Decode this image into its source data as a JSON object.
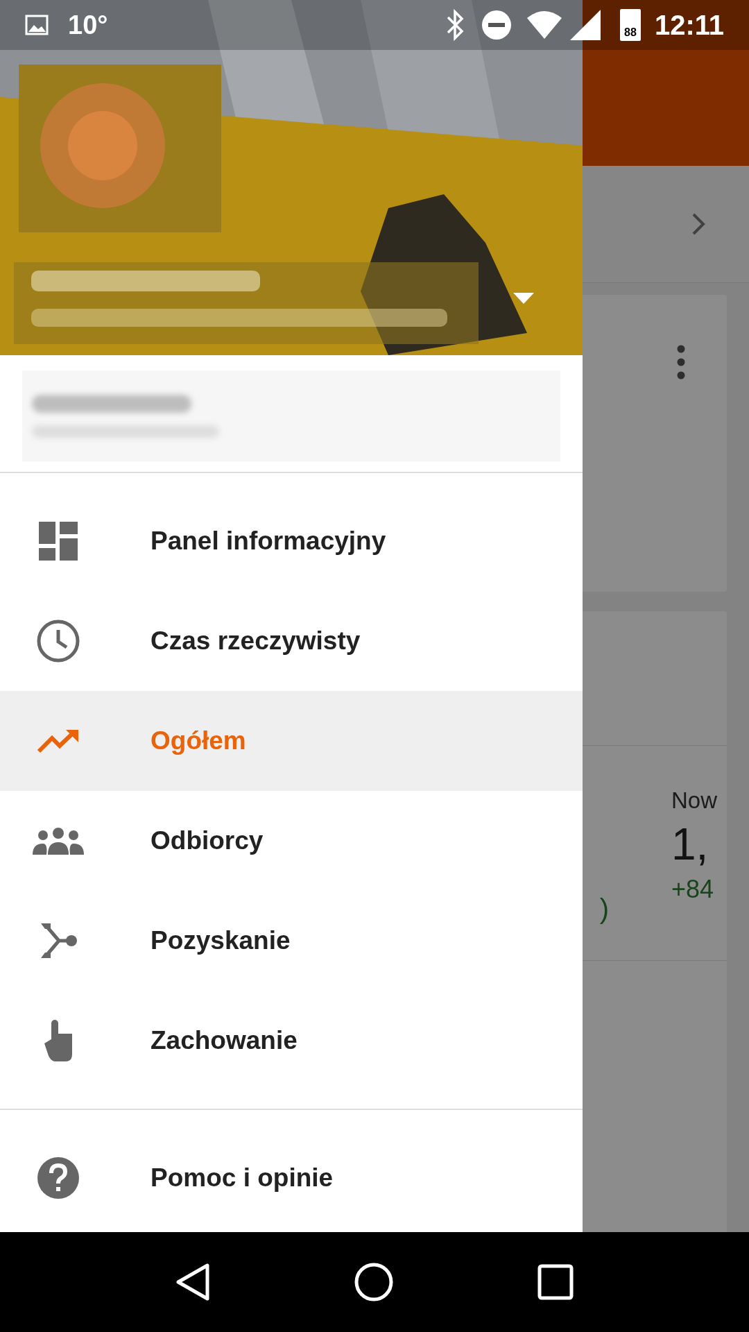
{
  "status_bar": {
    "temperature": "10°",
    "battery": "88",
    "time": "12:11"
  },
  "background_app": {
    "card_texts": [
      {
        "kind": "label",
        "text": "Now"
      },
      {
        "kind": "value",
        "text": "1,"
      },
      {
        "kind": "paren",
        "text": ")"
      },
      {
        "kind": "delta",
        "text": "+84"
      }
    ]
  },
  "drawer": {
    "menu": [
      {
        "kind": "dashboard",
        "label": "Panel informacyjny",
        "selected": false
      },
      {
        "kind": "clock",
        "label": "Czas rzeczywisty",
        "selected": false
      },
      {
        "kind": "trend",
        "label": "Ogółem",
        "selected": true
      },
      {
        "kind": "people",
        "label": "Odbiorcy",
        "selected": false
      },
      {
        "kind": "merge",
        "label": "Pozyskanie",
        "selected": false
      },
      {
        "kind": "touch",
        "label": "Zachowanie",
        "selected": false
      }
    ],
    "footer": [
      {
        "kind": "help",
        "label": "Pomoc i opinie",
        "selected": false
      }
    ]
  }
}
